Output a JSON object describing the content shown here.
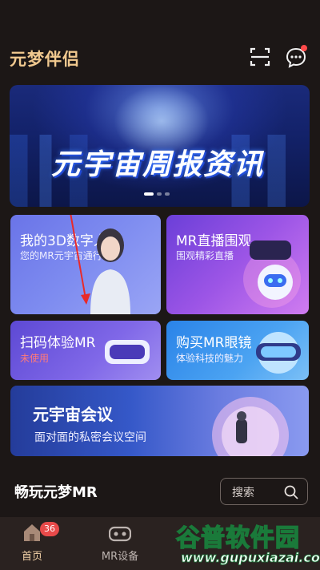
{
  "header": {
    "app_title": "元梦伴侣"
  },
  "banner": {
    "title": "元宇宙周报资讯"
  },
  "cards": {
    "digital_human": {
      "title": "我的3D数字人",
      "subtitle": "您的MR元宇宙通行证"
    },
    "live": {
      "title": "MR直播围观",
      "subtitle": "围观精彩直播"
    },
    "scan": {
      "title": "扫码体验MR",
      "subtitle": "未使用"
    },
    "buy": {
      "title": "购买MR眼镜",
      "subtitle": "体验科技的魅力"
    },
    "meeting": {
      "title": "元宇宙会议",
      "subtitle": "面对面的私密会议空间"
    }
  },
  "section": {
    "title": "畅玩元梦MR",
    "search_label": "搜索"
  },
  "tabbar": {
    "home": {
      "label": "首页",
      "badge": "36"
    },
    "devices": {
      "label": "MR设备"
    }
  },
  "watermark": {
    "brand": "谷普软件园",
    "url": "www.gupuxiazai.com"
  },
  "colors": {
    "accent_gold": "#f1c98f",
    "background": "#1c1716",
    "badge_red": "#e84a4a"
  }
}
